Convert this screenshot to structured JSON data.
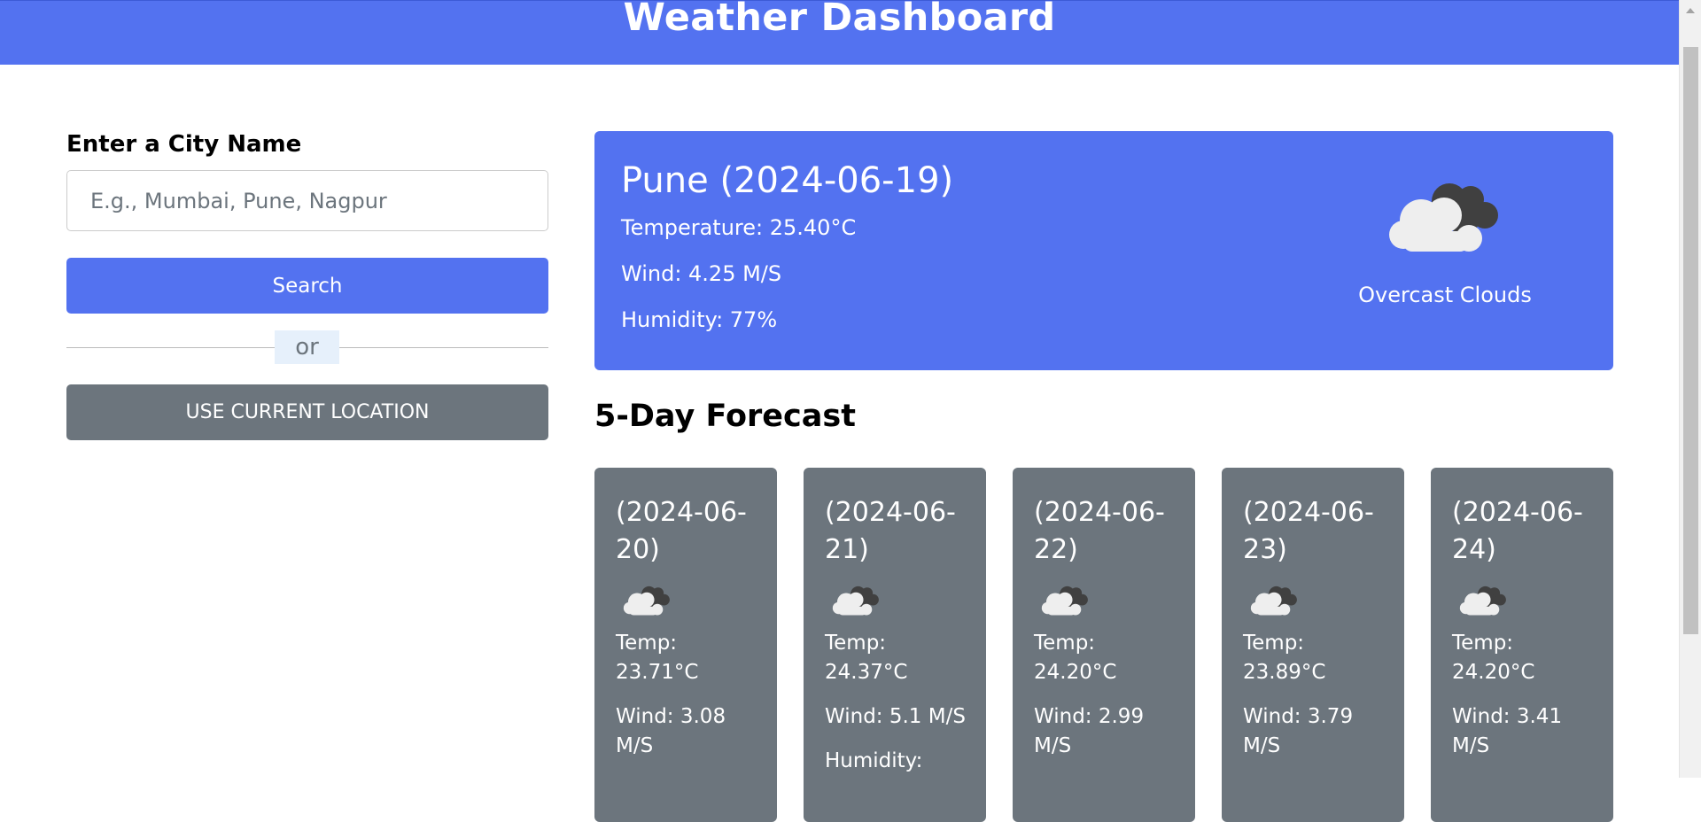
{
  "header": {
    "title": "Weather Dashboard"
  },
  "search": {
    "label": "Enter a City Name",
    "placeholder": "E.g., Mumbai, Pune, Nagpur",
    "value": "",
    "search_button": "Search",
    "separator": "or",
    "location_button": "USE CURRENT LOCATION"
  },
  "current": {
    "title": "Pune (2024-06-19)",
    "temperature": "Temperature: 25.40°C",
    "wind": "Wind: 4.25 M/S",
    "humidity": "Humidity: 77%",
    "icon": "overcast-clouds-icon",
    "description": "Overcast Clouds"
  },
  "forecast_heading": "5-Day Forecast",
  "forecast": [
    {
      "date": "(2024-06-20)",
      "temp": "Temp: 23.71°C",
      "wind": "Wind: 3.08 M/S",
      "humidity": ""
    },
    {
      "date": "(2024-06-21)",
      "temp": "Temp: 24.37°C",
      "wind": "Wind: 5.1 M/S",
      "humidity": "Humidity:"
    },
    {
      "date": "(2024-06-22)",
      "temp": "Temp: 24.20°C",
      "wind": "Wind: 2.99 M/S",
      "humidity": ""
    },
    {
      "date": "(2024-06-23)",
      "temp": "Temp: 23.89°C",
      "wind": "Wind: 3.79 M/S",
      "humidity": ""
    },
    {
      "date": "(2024-06-24)",
      "temp": "Temp: 24.20°C",
      "wind": "Wind: 3.41 M/S",
      "humidity": ""
    }
  ],
  "colors": {
    "primary": "#5372f0",
    "secondary": "#6c757d",
    "separator_bg": "#e6f0fb"
  }
}
